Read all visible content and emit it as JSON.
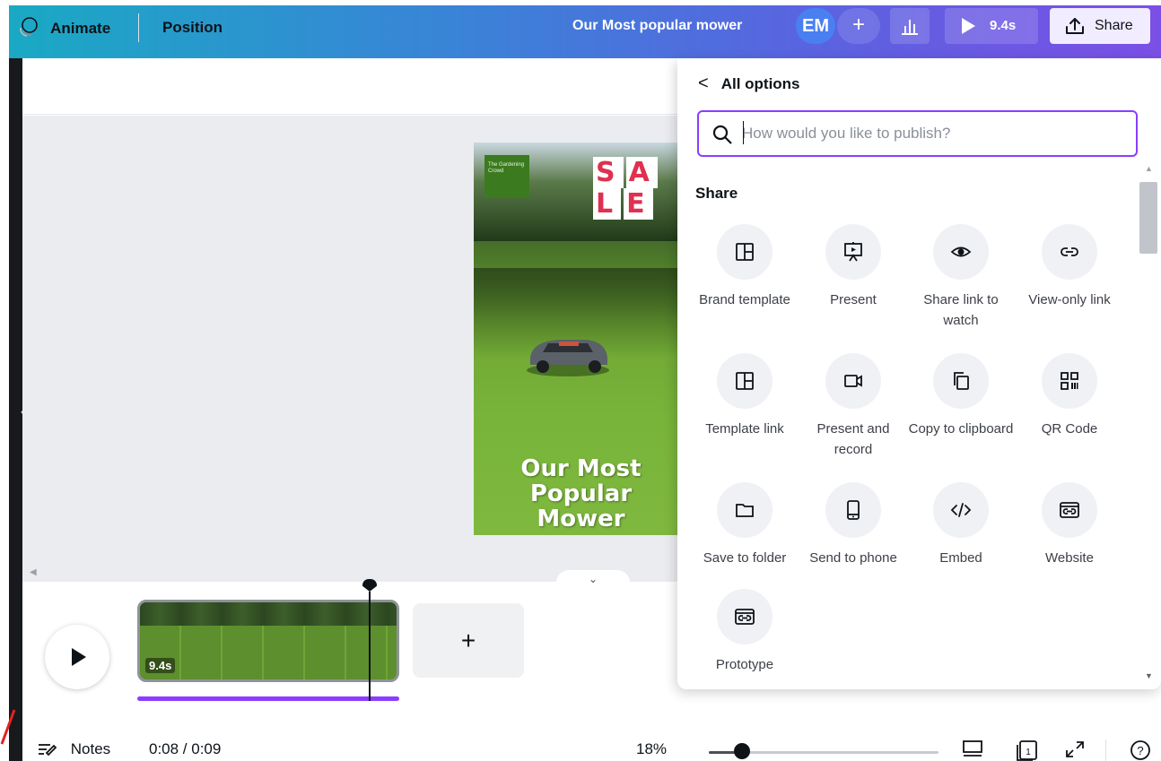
{
  "header": {
    "doc_title": "Our Most popular mower",
    "avatar_initials": "EM",
    "add_collaborator": "+",
    "play_duration": "9.4s",
    "share_label": "Share"
  },
  "left_rail": {
    "expand_glyph": "‹"
  },
  "toolbar": {
    "animate_label": "Animate",
    "position_label": "Position"
  },
  "design": {
    "brand_text": "The Gardening Crowd",
    "sale_letters": [
      "S",
      "A",
      "L",
      "E"
    ],
    "headline": "Our Most Popular Mower"
  },
  "timeline": {
    "clip_duration": "9.4s",
    "add_page_glyph": "+",
    "collapse_glyph": "⌄"
  },
  "footer": {
    "notes_label": "Notes",
    "time_readout": "0:08 / 0:09",
    "zoom": "18%",
    "zoom_level_fraction": 0.18,
    "page_number": "1",
    "help": "?"
  },
  "share_panel": {
    "back_label": "All options",
    "search_placeholder": "How would you like to publish?",
    "section_title": "Share",
    "options": [
      {
        "label": "Brand template",
        "icon": "brand-template-icon"
      },
      {
        "label": "Present",
        "icon": "present-icon"
      },
      {
        "label": "Share link to watch",
        "icon": "eye-icon"
      },
      {
        "label": "View-only link",
        "icon": "link-icon"
      },
      {
        "label": "Template link",
        "icon": "template-link-icon"
      },
      {
        "label": "Present and record",
        "icon": "camera-icon"
      },
      {
        "label": "Copy to clipboard",
        "icon": "copy-icon"
      },
      {
        "label": "QR Code",
        "icon": "qr-code-icon"
      },
      {
        "label": "Save to folder",
        "icon": "folder-icon"
      },
      {
        "label": "Send to phone",
        "icon": "phone-icon"
      },
      {
        "label": "Embed",
        "icon": "code-icon"
      },
      {
        "label": "Website",
        "icon": "website-icon"
      },
      {
        "label": "Prototype",
        "icon": "prototype-icon"
      }
    ]
  },
  "colors": {
    "accent": "#8b3dff",
    "header_gradient_start": "#1aa9c4",
    "header_gradient_end": "#7b4fe6",
    "avatar_bg": "#4a7ff2",
    "sale_red": "#e0304f"
  }
}
